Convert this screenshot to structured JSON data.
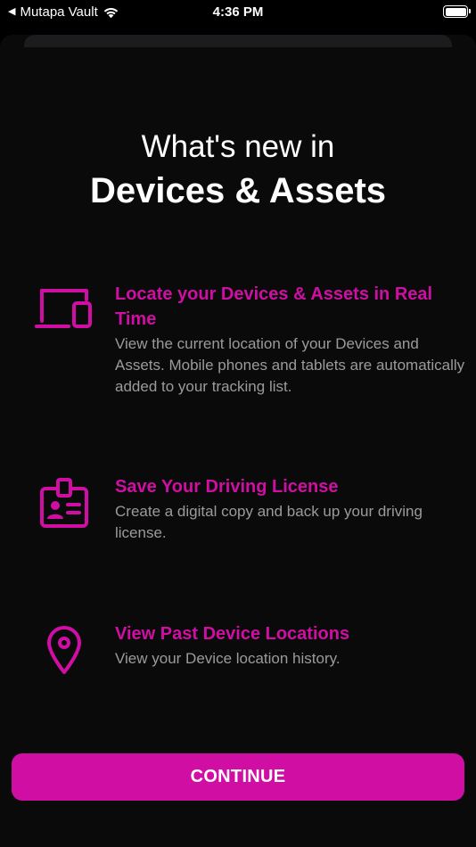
{
  "status_bar": {
    "back_app": "Mutapa Vault",
    "time": "4:36 PM"
  },
  "header": {
    "title_light": "What's new in",
    "title_bold": "Devices & Assets"
  },
  "features": [
    {
      "icon": "devices-icon",
      "title": "Locate your Devices & Assets in Real Time",
      "description": "View the current location of your Devices and Assets. Mobile phones and tablets are automatically added to your tracking list."
    },
    {
      "icon": "id-badge-icon",
      "title": "Save Your Driving License",
      "description": "Create a digital copy and back up your driving license."
    },
    {
      "icon": "location-pin-icon",
      "title": "View Past Device Locations",
      "description": "View your Device location history."
    }
  ],
  "continue_label": "CONTINUE",
  "colors": {
    "accent": "#d10ea4",
    "description": "#9b9b9b",
    "background": "#000000"
  }
}
